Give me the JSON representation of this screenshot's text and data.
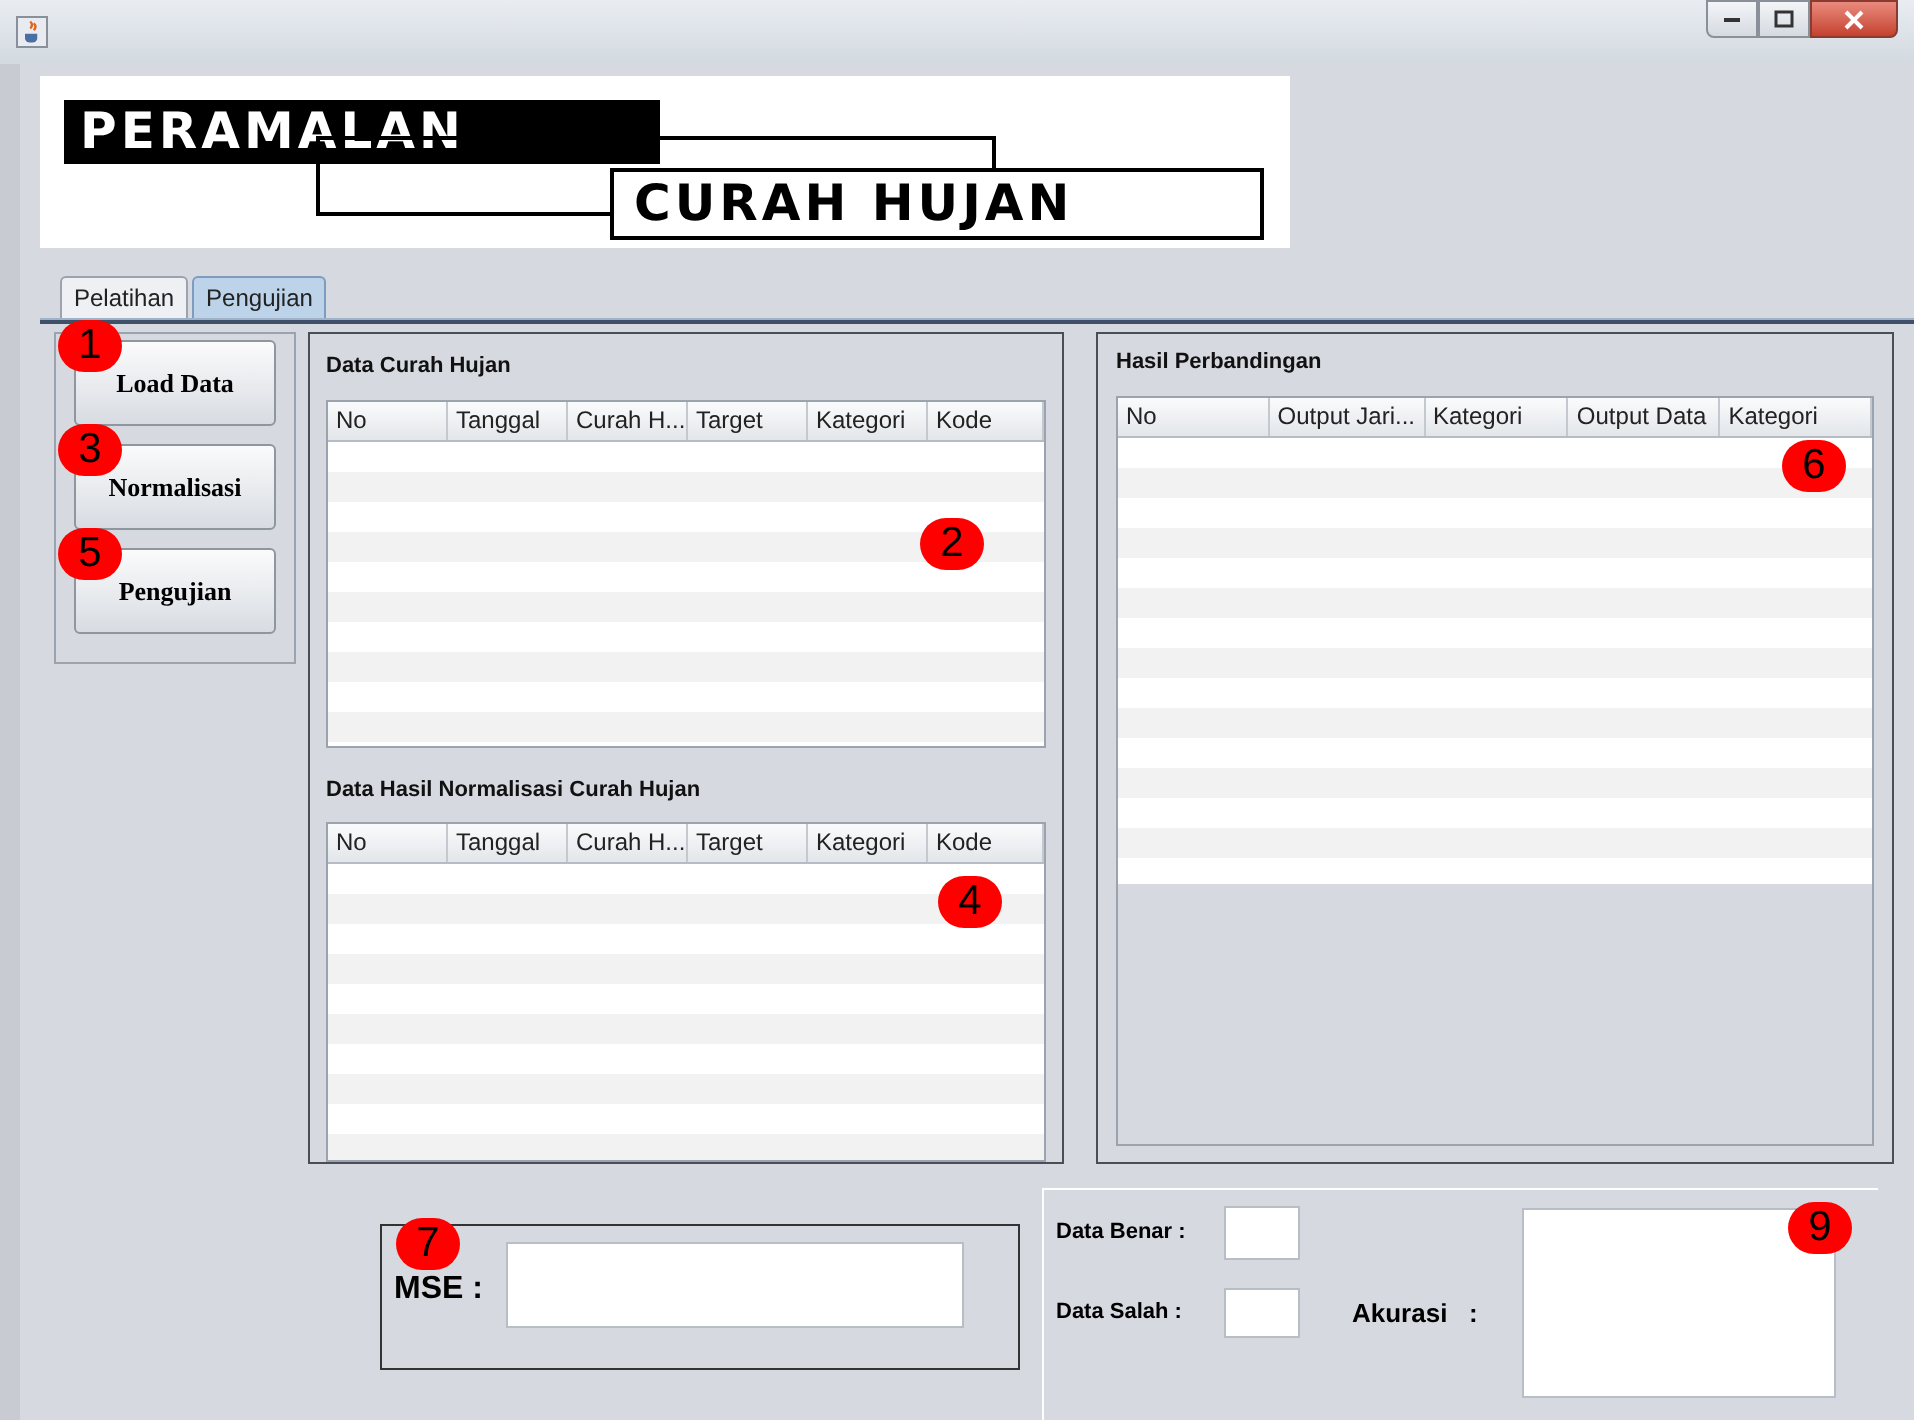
{
  "logo": {
    "line_1": "PERAMALAN",
    "line_2": "CURAH HUJAN"
  },
  "tabs": [
    {
      "label": "Pelatihan",
      "selected": false
    },
    {
      "label": "Pengujian",
      "selected": true
    }
  ],
  "buttons": [
    {
      "label": "Load Data",
      "marker": "1"
    },
    {
      "label": "Normalisasi",
      "marker": "3"
    },
    {
      "label": "Pengujian",
      "marker": "5"
    }
  ],
  "data_table": {
    "title": "Data Curah Hujan",
    "columns": [
      "No",
      "Tanggal",
      "Curah H...",
      "Target",
      "Kategori",
      "Kode"
    ],
    "marker": "2"
  },
  "normalized_table": {
    "title": "Data Hasil Normalisasi Curah Hujan",
    "columns": [
      "No",
      "Tanggal",
      "Curah H...",
      "Target",
      "Kategori",
      "Kode"
    ],
    "marker": "4"
  },
  "comparison_table": {
    "title": "Hasil Perbandingan",
    "columns": [
      "No",
      "Output Jari...",
      "Kategori",
      "Output Data",
      "Kategori"
    ],
    "marker": "6"
  },
  "mse": {
    "label": "MSE :",
    "marker": "7"
  },
  "results": {
    "correct_label": "Data Benar :",
    "wrong_label": "Data Salah :",
    "accuracy_label": "Akurasi   :",
    "marker": "9"
  }
}
